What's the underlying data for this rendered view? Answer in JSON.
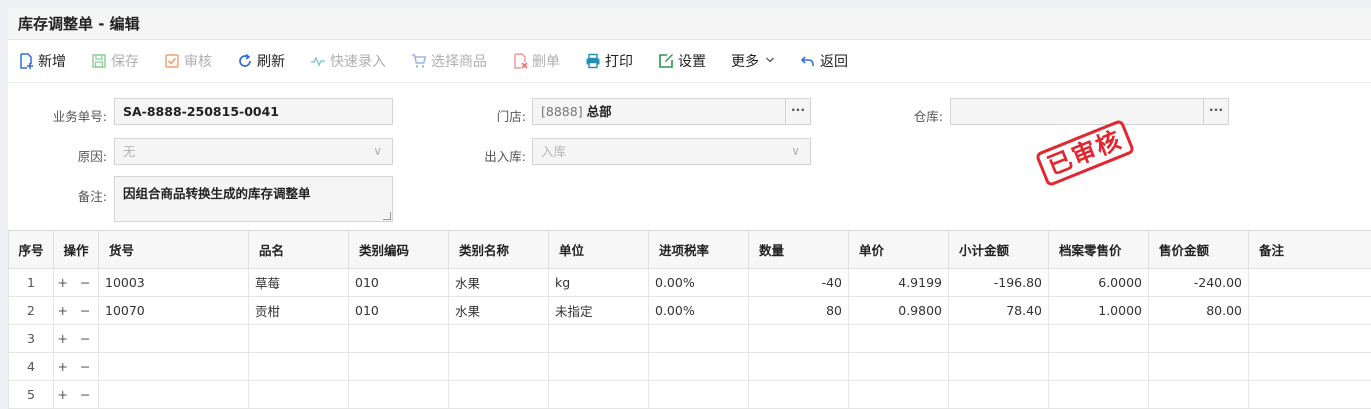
{
  "title": "库存调整单 - 编辑",
  "toolbar": [
    {
      "label": "新增",
      "icon": "new-doc-icon",
      "disabled": false
    },
    {
      "label": "保存",
      "icon": "save-icon",
      "disabled": true
    },
    {
      "label": "审核",
      "icon": "check-icon",
      "disabled": true
    },
    {
      "label": "刷新",
      "icon": "refresh-icon",
      "disabled": false
    },
    {
      "label": "快速录入",
      "icon": "pulse-icon",
      "disabled": true
    },
    {
      "label": "选择商品",
      "icon": "cart-icon",
      "disabled": true
    },
    {
      "label": "删单",
      "icon": "delete-doc-icon",
      "disabled": true
    },
    {
      "label": "打印",
      "icon": "print-icon",
      "disabled": false
    },
    {
      "label": "设置",
      "icon": "edit-icon",
      "disabled": false
    },
    {
      "label": "更多",
      "icon": "chevron-down-icon",
      "disabled": false
    },
    {
      "label": "返回",
      "icon": "back-icon",
      "disabled": false
    }
  ],
  "form": {
    "order_no_label": "业务单号:",
    "order_no": "SA-8888-250815-0041",
    "store_label": "门店:",
    "store_code": "[8888]",
    "store_name": "总部",
    "warehouse_label": "仓库:",
    "warehouse": "",
    "reason_label": "原因:",
    "reason": "无",
    "io_label": "出入库:",
    "io": "入库",
    "note_label": "备注:",
    "note": "因组合商品转换生成的库存调整单",
    "picker_glyph": "···",
    "dropdown_glyph": "∨"
  },
  "stamp": "已审核",
  "table": {
    "headers": [
      "序号",
      "操作",
      "货号",
      "品名",
      "类别编码",
      "类别名称",
      "单位",
      "进项税率",
      "数量",
      "单价",
      "小计金额",
      "档案零售价",
      "售价金额",
      "备注"
    ],
    "op_glyph": "+ −",
    "rows": [
      {
        "no": "1",
        "sku": "10003",
        "name": "草莓",
        "cat_code": "010",
        "cat_name": "水果",
        "unit": "kg",
        "tax": "0.00%",
        "qty": "-40",
        "price": "4.9199",
        "subtotal": "-196.80",
        "retail": "6.0000",
        "sale_amount": "-240.00",
        "note": ""
      },
      {
        "no": "2",
        "sku": "10070",
        "name": "贡柑",
        "cat_code": "010",
        "cat_name": "水果",
        "unit": "未指定",
        "tax": "0.00%",
        "qty": "80",
        "price": "0.9800",
        "subtotal": "78.40",
        "retail": "1.0000",
        "sale_amount": "80.00",
        "note": ""
      },
      {
        "no": "3",
        "sku": "",
        "name": "",
        "cat_code": "",
        "cat_name": "",
        "unit": "",
        "tax": "",
        "qty": "",
        "price": "",
        "subtotal": "",
        "retail": "",
        "sale_amount": "",
        "note": ""
      },
      {
        "no": "4",
        "sku": "",
        "name": "",
        "cat_code": "",
        "cat_name": "",
        "unit": "",
        "tax": "",
        "qty": "",
        "price": "",
        "subtotal": "",
        "retail": "",
        "sale_amount": "",
        "note": ""
      },
      {
        "no": "5",
        "sku": "",
        "name": "",
        "cat_code": "",
        "cat_name": "",
        "unit": "",
        "tax": "",
        "qty": "",
        "price": "",
        "subtotal": "",
        "retail": "",
        "sale_amount": "",
        "note": ""
      }
    ]
  },
  "colors": {
    "accent": "#2f6fd6",
    "stamp": "#e3262f",
    "disabled": "#b0b0b0"
  }
}
